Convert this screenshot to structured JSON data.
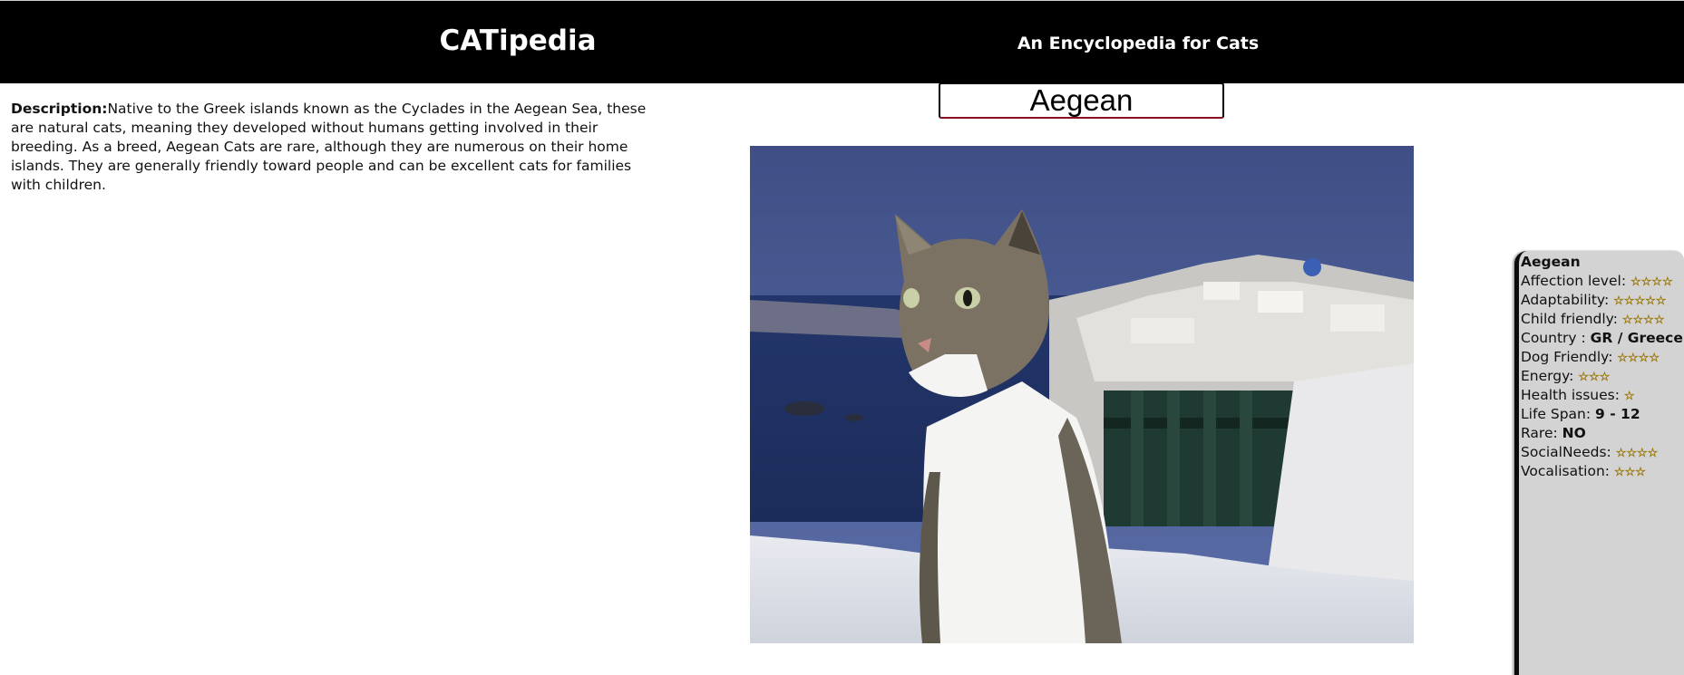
{
  "header": {
    "title": "CATipedia",
    "tagline": "An Encyclopedia for Cats"
  },
  "search": {
    "value": "Aegean"
  },
  "description": {
    "label": "Description:",
    "text": "Native to the Greek islands known as the Cyclades in the Aegean Sea, these are natural cats, meaning they developed without humans getting involved in their breeding. As a breed, Aegean Cats are rare, although they are numerous on their home islands. They are generally friendly toward people and can be excellent cats for families with children."
  },
  "photo": {
    "icon": "cat-photo"
  },
  "info": {
    "name": "Aegean",
    "affection": {
      "label": "Affection level:",
      "stars": "☆☆☆☆",
      "rating": 4
    },
    "adaptability": {
      "label": "Adaptability:",
      "stars": "☆☆☆☆☆",
      "rating": 5
    },
    "child_friendly": {
      "label": "Child friendly:",
      "stars": "☆☆☆☆",
      "rating": 4
    },
    "country": {
      "label": "Country :",
      "value": "GR / Greece"
    },
    "dog_friendly": {
      "label": "Dog Friendly:",
      "stars": "☆☆☆☆",
      "rating": 4
    },
    "energy": {
      "label": "Energy:",
      "stars": "☆☆☆",
      "rating": 3
    },
    "health": {
      "label": "Health issues:",
      "stars": "☆",
      "rating": 1
    },
    "life_span": {
      "label": "Life Span:",
      "value": "9 - 12"
    },
    "rare": {
      "label": "Rare:",
      "value": "NO"
    },
    "social": {
      "label": "SocialNeeds:",
      "stars": "☆☆☆☆",
      "rating": 4
    },
    "vocalisation": {
      "label": "Vocalisation:",
      "stars": "☆☆☆",
      "rating": 3
    },
    "star_color": "#f3c02a"
  }
}
